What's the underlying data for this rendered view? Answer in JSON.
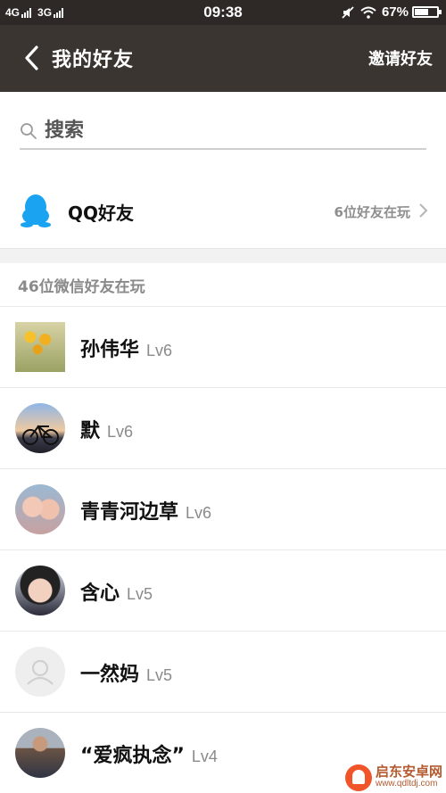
{
  "status_bar": {
    "network1": "4G",
    "network2": "3G",
    "time": "09:38",
    "battery": "67%",
    "battery_level": 0.67
  },
  "header": {
    "back_icon": "chevron-left-icon",
    "title": "我的好友",
    "invite_label": "邀请好友"
  },
  "search": {
    "placeholder": "搜索",
    "icon": "search-icon"
  },
  "qq": {
    "icon": "qq-penguin-icon",
    "label": "QQ好友",
    "count_text": "6位好友在玩",
    "color": "#1aa3f0"
  },
  "section": {
    "title": "46位微信好友在玩"
  },
  "friends": [
    {
      "name": "孙伟华",
      "level": "Lv6"
    },
    {
      "name": "默",
      "level": "Lv6"
    },
    {
      "name": "青青河边草",
      "level": "Lv6"
    },
    {
      "name": "含心",
      "level": "Lv5"
    },
    {
      "name": "一然妈",
      "level": "Lv5"
    },
    {
      "name": "“爱疯执念”",
      "level": "Lv4"
    }
  ],
  "watermark": {
    "name": "启东安卓网",
    "url": "www.qdltdj.com"
  },
  "colors": {
    "header_bg": "#3b3532",
    "status_bg": "#2e2926",
    "qq_blue": "#1aa3f0",
    "muted_text": "#8a8a8a"
  }
}
